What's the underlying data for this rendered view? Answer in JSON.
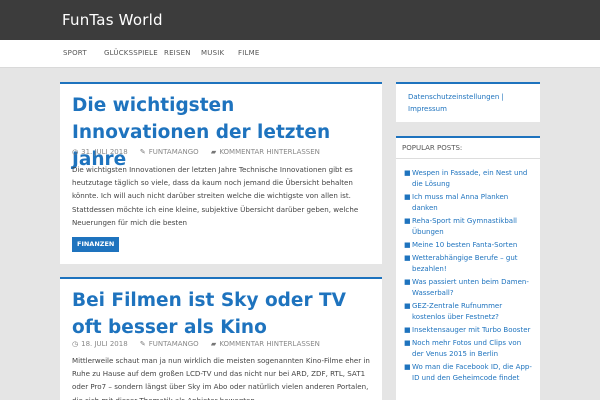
{
  "site": {
    "title": "FunTas World"
  },
  "nav": [
    "SPORT",
    "GLÜCKSSPIELE",
    "REISEN",
    "MUSIK",
    "FILME"
  ],
  "posts": [
    {
      "title": "Die wichtigsten Innovationen der letzten Jahre",
      "date": "31. JULI 2018",
      "author": "FUNTAMANGO",
      "comments": "KOMMENTAR HINTERLASSEN",
      "excerpt": "Die wichtigsten Innovationen der letzten Jahre Technische Innovationen gibt es heutzutage täglich so viele, dass da kaum noch jemand die Übersicht behalten könnte. Ich will auch nicht darüber streiten welche die wichtigste von allen ist. Stattdessen möchte ich eine kleine, subjektive Übersicht darüber geben, welche Neuerungen für mich die besten",
      "category": "FINANZEN"
    },
    {
      "title": "Bei Filmen ist Sky oder TV oft besser als Kino",
      "date": "18. JULI 2018",
      "author": "FUNTAMANGO",
      "comments": "KOMMENTAR HINTERLASSEN",
      "excerpt": "Mittlerweile schaut man ja nun wirklich die meisten sogenannten Kino-Filme eher in Ruhe zu Hause auf dem großen LCD-TV und das nicht nur bei ARD, ZDF, RTL, SAT1 oder Pro7 – sondern längst über Sky im Abo oder natürlich vielen anderen Portalen, die sich mit dieser Thematik als Anbieter bewegten."
    }
  ],
  "sidebar": {
    "links": "Datenschutzeinstellungen | Impressum",
    "popular_title": "POPULAR POSTS:",
    "popular": [
      "Wespen in Fassade, ein Nest und die Lösung",
      "Ich muss mal Anna Planken danken",
      "Reha-Sport mit Gymnastikball Übungen",
      "Meine 10 besten Fanta-Sorten",
      "Wetterabhängige Berufe – gut bezahlen!",
      "Was passiert unten beim Damen-Wasserball?",
      "GEZ-Zentrale Rufnummer kostenlos über Festnetz?",
      "Insektensauger mit Turbo Booster",
      "Noch mehr Fotos und Clips von der Venus 2015 in Berlin",
      "Wo man die Facebook ID, die App-ID und den Geheimcode findet"
    ]
  },
  "colors": {
    "accent": "#1e73be",
    "topbar": "#3c3c3c",
    "background": "#e5e5e5"
  },
  "icons": {
    "date": "clock-icon",
    "author": "pencil-icon",
    "comments": "speech-bubble-icon",
    "bullet": "square-bullet-icon"
  }
}
